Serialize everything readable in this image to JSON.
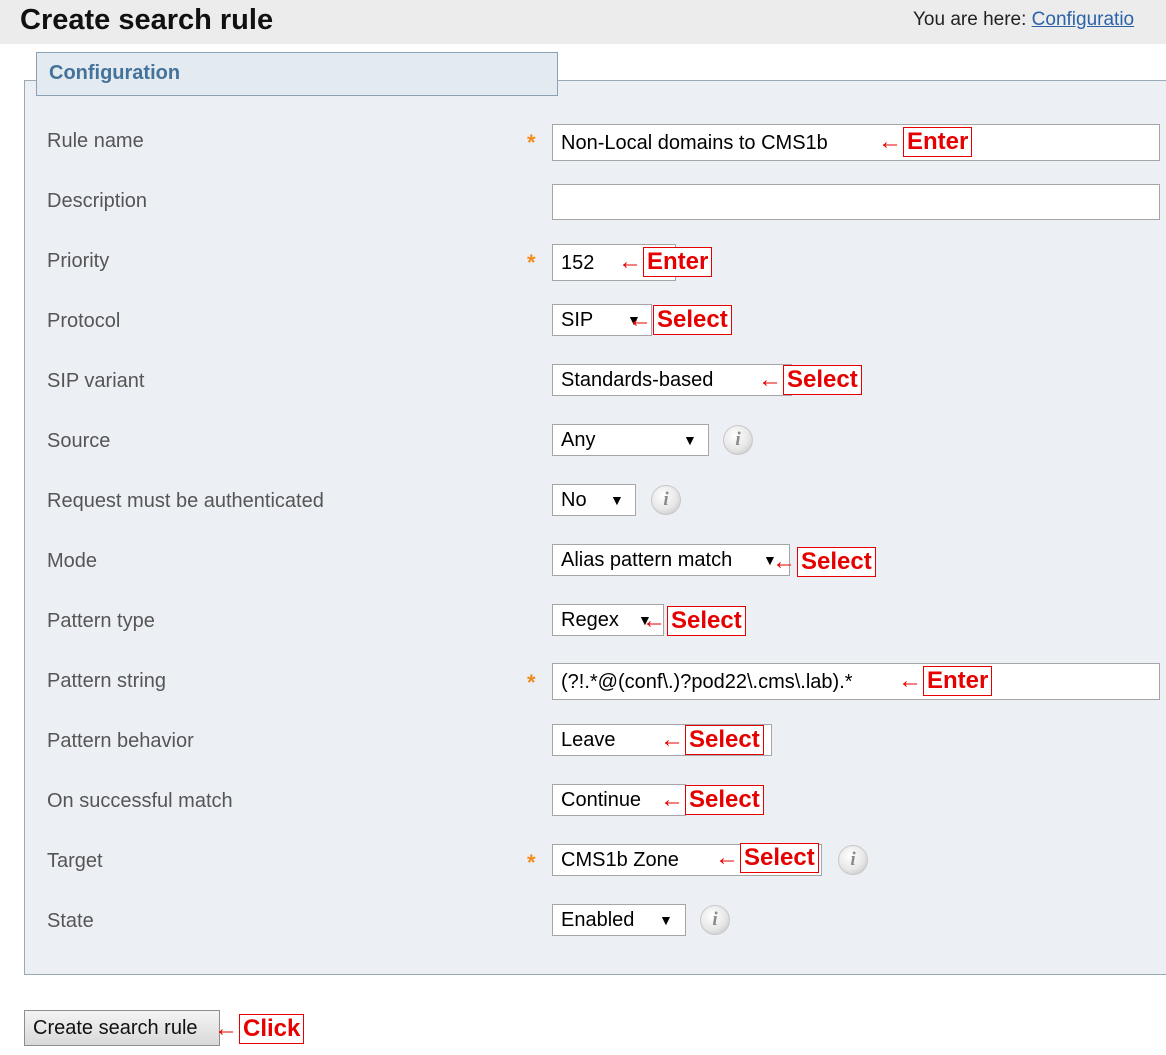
{
  "header": {
    "title": "Create search rule",
    "breadcrumb_prefix": "You are here:",
    "breadcrumb_link": "Configuratio"
  },
  "section": {
    "legend": "Configuration"
  },
  "form": {
    "rule_name": {
      "label": "Rule name",
      "value": "Non-Local domains to CMS1b",
      "required": "*",
      "annotation": "Enter"
    },
    "description": {
      "label": "Description",
      "value": ""
    },
    "priority": {
      "label": "Priority",
      "value": "152",
      "required": "*",
      "annotation": "Enter"
    },
    "protocol": {
      "label": "Protocol",
      "value": "SIP",
      "annotation": "Select"
    },
    "sip_variant": {
      "label": "SIP variant",
      "value": "Standards-based",
      "annotation": "Select"
    },
    "source": {
      "label": "Source",
      "value": "Any"
    },
    "request_auth": {
      "label": "Request must be authenticated",
      "value": "No"
    },
    "mode": {
      "label": "Mode",
      "value": "Alias pattern match",
      "annotation": "Select"
    },
    "pattern_type": {
      "label": "Pattern type",
      "value": "Regex",
      "annotation": "Select"
    },
    "pattern_string": {
      "label": "Pattern string",
      "value": "(?!.*@(conf\\.)?pod22\\.cms\\.lab).*",
      "required": "*",
      "annotation": "Enter"
    },
    "pattern_behavior": {
      "label": "Pattern behavior",
      "value": "Leave",
      "annotation": "Select"
    },
    "on_success": {
      "label": "On successful match",
      "value": "Continue",
      "annotation": "Select"
    },
    "target": {
      "label": "Target",
      "value": "CMS1b Zone",
      "required": "*",
      "annotation": "Select"
    },
    "state": {
      "label": "State",
      "value": "Enabled"
    }
  },
  "actions": {
    "submit_label": "Create search rule",
    "submit_annotation": "Click"
  },
  "icons": {
    "dropdown": "▼",
    "arrow": "←",
    "info": "i"
  },
  "colors": {
    "annotation": "#e60000",
    "required": "#f08a1c",
    "legend_text": "#45729a",
    "link": "#2c63a8"
  }
}
